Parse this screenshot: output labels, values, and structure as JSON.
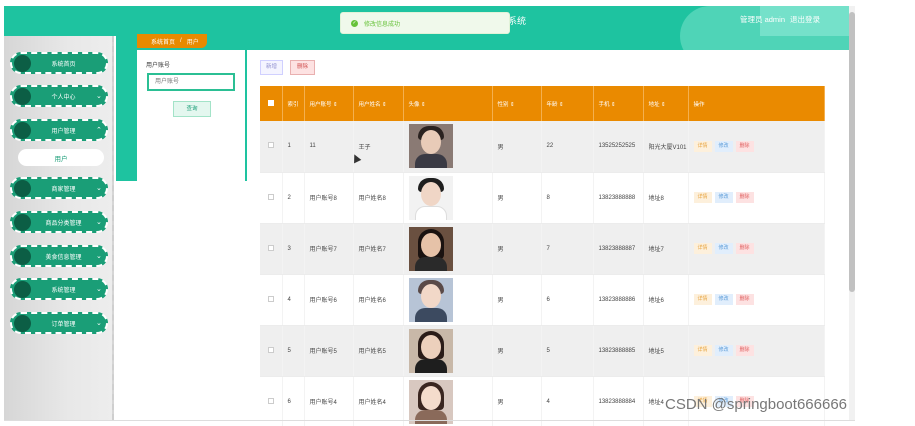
{
  "header": {
    "system_title": "系统",
    "admin_label": "管理员 admin",
    "logout_label": "退出登录"
  },
  "toast": {
    "message": "修改信息成功"
  },
  "sidebar": {
    "items": [
      {
        "label": "系统首页",
        "has_chevron": false
      },
      {
        "label": "个人中心",
        "has_chevron": true
      },
      {
        "label": "用户管理",
        "has_chevron": true,
        "expanded": true
      },
      {
        "label": "商家管理",
        "has_chevron": true
      },
      {
        "label": "商品分类管理",
        "has_chevron": true
      },
      {
        "label": "美食信息管理",
        "has_chevron": true
      },
      {
        "label": "系统管理",
        "has_chevron": true
      },
      {
        "label": "订单管理",
        "has_chevron": true
      }
    ],
    "sub_item": "用户"
  },
  "breadcrumb": {
    "home": "系统首页",
    "separator": "/",
    "current": "用户"
  },
  "search": {
    "label": "用户账号",
    "placeholder": "用户账号",
    "button": "查询"
  },
  "toolbar": {
    "add_label": "新增",
    "delete_label": "删除"
  },
  "table": {
    "headers": [
      "索引",
      "用户账号",
      "用户姓名",
      "头像",
      "性别",
      "年龄",
      "手机",
      "地址",
      "操作"
    ],
    "rows": [
      {
        "index": "1",
        "account": "11",
        "name": "王子",
        "gender": "男",
        "age": "22",
        "phone": "13525252525",
        "address": "阳光大厦V101",
        "avatar": "male-photo"
      },
      {
        "index": "2",
        "account": "用户账号8",
        "name": "用户姓名8",
        "gender": "男",
        "age": "8",
        "phone": "13823888888",
        "address": "地址8",
        "avatar": "male-photo"
      },
      {
        "index": "3",
        "account": "用户账号7",
        "name": "用户姓名7",
        "gender": "男",
        "age": "7",
        "phone": "13823888887",
        "address": "地址7",
        "avatar": "female-photo"
      },
      {
        "index": "4",
        "account": "用户账号6",
        "name": "用户姓名6",
        "gender": "男",
        "age": "6",
        "phone": "13823888886",
        "address": "地址6",
        "avatar": "male-photo"
      },
      {
        "index": "5",
        "account": "用户账号5",
        "name": "用户姓名5",
        "gender": "男",
        "age": "5",
        "phone": "13823888885",
        "address": "地址5",
        "avatar": "female-photo"
      },
      {
        "index": "6",
        "account": "用户账号4",
        "name": "用户姓名4",
        "gender": "男",
        "age": "4",
        "phone": "13823888884",
        "address": "地址4",
        "avatar": "female-photo"
      }
    ],
    "ops": {
      "detail": "详情",
      "edit": "修改",
      "delete": "删除"
    }
  },
  "watermark": "CSDN @springboot666666",
  "colors": {
    "primary": "#1ec3a0",
    "sidebar_green": "#1a9e77",
    "table_header": "#ea8a00"
  }
}
